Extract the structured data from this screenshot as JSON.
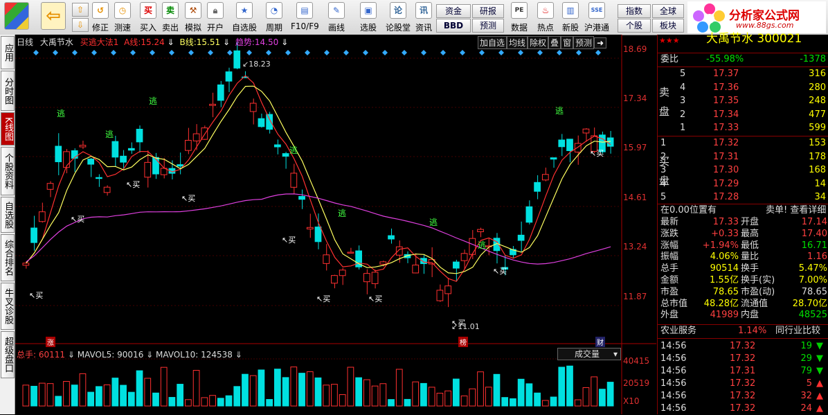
{
  "toolbar": {
    "buy": "买入",
    "sell": "卖出",
    "simulate": "模拟",
    "open_pos": "开户",
    "correct": "修正",
    "test": "测速",
    "items": [
      {
        "label": "自选股",
        "icon": "star-chart"
      },
      {
        "label": "周期",
        "icon": "clock-cycle"
      },
      {
        "label": "F10/F9",
        "icon": "document"
      },
      {
        "label": "画线",
        "icon": "pencil"
      },
      {
        "label": "选股",
        "icon": "screen"
      },
      {
        "label": "论股堂",
        "icon": "discuss"
      },
      {
        "label": "资讯",
        "icon": "news"
      }
    ],
    "small": [
      "资金",
      "BBD",
      "研报",
      "预测"
    ],
    "items2": [
      {
        "label": "数据",
        "icon": "pe-doc"
      },
      {
        "label": "热点",
        "icon": "fire"
      },
      {
        "label": "新股",
        "icon": "ipo"
      },
      {
        "label": "沪港通",
        "icon": "hk-connect"
      }
    ],
    "small2": [
      "指数",
      "个股",
      "全球",
      "板块"
    ],
    "buy_ico": "买",
    "sell_ico": "卖",
    "correct_ico": "↺"
  },
  "brand": {
    "name": "分析家公式网",
    "url": "www.88gs.com"
  },
  "leftnav": [
    "应用",
    "分时图",
    "K线图",
    "个股资料",
    "自选股",
    "综合排名",
    "牛叉诊股",
    "超级盘口"
  ],
  "chart": {
    "period": "日线",
    "stock": "大禹节水",
    "indicator": "买逃大法1",
    "a_label": "A线:",
    "a_value": "15.24",
    "b_label": "B线:",
    "b_value": "15.51",
    "trend_label": "趋势:",
    "trend_value": "14.50",
    "buttons": [
      "加自选",
      "均线",
      "除权",
      "叠",
      "窗",
      "预测"
    ],
    "price_ticks": [
      "18.69",
      "17.34",
      "15.97",
      "14.61",
      "13.24",
      "11.87"
    ],
    "high_label": "18.23",
    "low_label": "11.01",
    "vol_ticks": [
      "40415",
      "20519",
      "X10"
    ],
    "vol_header": {
      "total": "总手: 60111",
      "mavol5": "MAVOL5: 90016",
      "mavol10": "MAVOL10: 124538"
    },
    "vol_dropdown": "成交量",
    "signal_buy": "买",
    "signal_escape": "逃",
    "marker_zhang": "涨",
    "marker_bang": "榜",
    "marker_cai": "财"
  },
  "quote": {
    "title": "大禹节水 300021",
    "webi_label": "委比",
    "webi_value": "-55.98%",
    "webi_diff": "-1378",
    "sell_side_label": "卖盘",
    "buy_side_label": "买盘",
    "asks": [
      {
        "level": "5",
        "price": "17.37",
        "vol": "316"
      },
      {
        "level": "4",
        "price": "17.36",
        "vol": "280"
      },
      {
        "level": "3",
        "price": "17.35",
        "vol": "248"
      },
      {
        "level": "2",
        "price": "17.34",
        "vol": "477"
      },
      {
        "level": "1",
        "price": "17.33",
        "vol": "599"
      }
    ],
    "bids": [
      {
        "level": "1",
        "price": "17.32",
        "vol": "153"
      },
      {
        "level": "2",
        "price": "17.31",
        "vol": "178"
      },
      {
        "level": "3",
        "price": "17.30",
        "vol": "168"
      },
      {
        "level": "4",
        "price": "17.29",
        "vol": "14"
      },
      {
        "level": "5",
        "price": "17.28",
        "vol": "34"
      }
    ],
    "position_note": "在0.00位置有",
    "detail_link": "卖单! 查看详细",
    "stats": [
      {
        "l": "最新",
        "v": "17.33",
        "l2": "开盘",
        "v2": "17.14"
      },
      {
        "l": "涨跌",
        "v": "+0.33",
        "l2": "最高",
        "v2": "17.40"
      },
      {
        "l": "涨幅",
        "v": "+1.94%",
        "l2": "最低",
        "v2": "16.71"
      },
      {
        "l": "振幅",
        "v": "4.06%",
        "l2": "量比",
        "v2": "1.16"
      },
      {
        "l": "总手",
        "v": "90514",
        "l2": "换手",
        "v2": "5.47%"
      },
      {
        "l": "金额",
        "v": "1.55亿",
        "l2": "换手(实)",
        "v2": "7.00%"
      },
      {
        "l": "市盈",
        "v": "78.65",
        "l2": "市盈(动)",
        "v2": "78.65"
      },
      {
        "l": "总市值",
        "v": "48.28亿",
        "l2": "流通值",
        "v2": "28.70亿"
      },
      {
        "l": "外盘",
        "v": "41989",
        "l2": "内盘",
        "v2": "48525"
      }
    ],
    "sector_name": "农业服务",
    "sector_change": "1.14%",
    "sector_compare": "同行业比较",
    "ticks": [
      {
        "t": "14:56",
        "p": "17.32",
        "v": "19",
        "d": "down"
      },
      {
        "t": "14:56",
        "p": "17.32",
        "v": "29",
        "d": "down"
      },
      {
        "t": "14:56",
        "p": "17.31",
        "v": "79",
        "d": "down"
      },
      {
        "t": "14:56",
        "p": "17.32",
        "v": "5",
        "d": "up"
      },
      {
        "t": "14:56",
        "p": "17.32",
        "v": "32",
        "d": "up"
      },
      {
        "t": "14:56",
        "p": "17.32",
        "v": "24",
        "d": "up"
      }
    ]
  }
}
